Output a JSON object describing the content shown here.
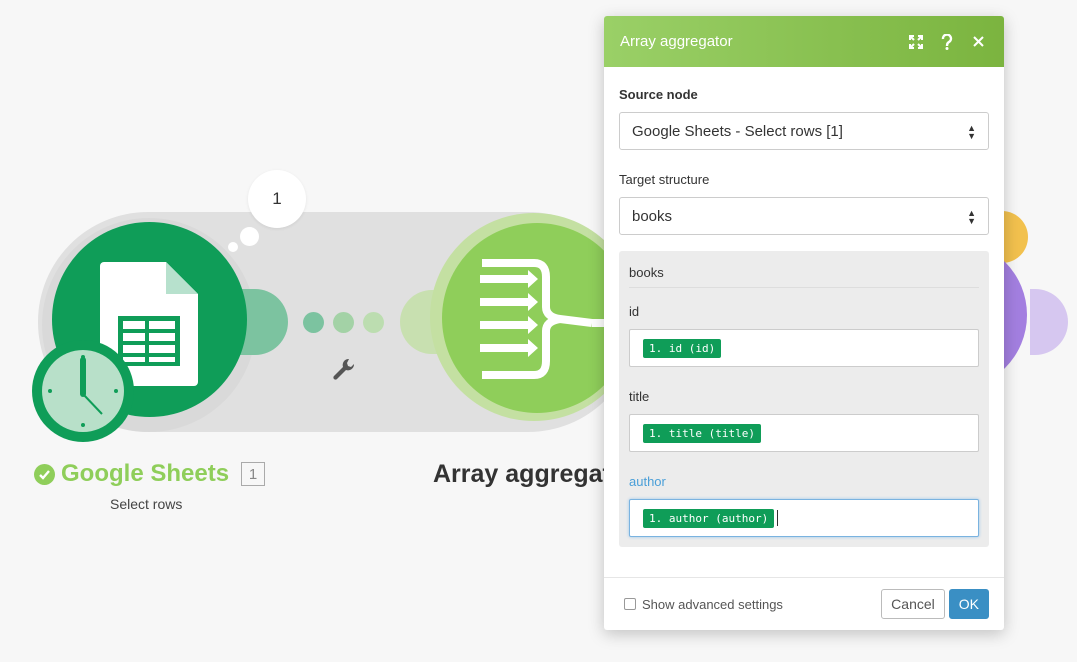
{
  "canvas": {
    "modules": [
      {
        "title": "Google Sheets",
        "subtitle": "Select rows",
        "badge": "1",
        "bubble_count": "1",
        "color": "#0f9d58",
        "icon": "google-sheets-icon"
      },
      {
        "title": "Array aggregator",
        "color": "#8fce5a",
        "icon": "array-aggregator-icon"
      }
    ],
    "connector_icon": "wrench-icon"
  },
  "dialog": {
    "title": "Array aggregator",
    "header_icons": [
      "expand-icon",
      "help-icon",
      "close-icon"
    ],
    "source_node": {
      "label": "Source node",
      "value": "Google Sheets - Select rows [1]"
    },
    "target_structure": {
      "label": "Target structure",
      "value": "books"
    },
    "structure": {
      "name": "books",
      "fields": [
        {
          "label": "id",
          "value": "1. id (id)"
        },
        {
          "label": "title",
          "value": "1. title (title)"
        },
        {
          "label": "author",
          "value": "1. author (author)"
        }
      ]
    },
    "footer": {
      "advanced_label": "Show advanced settings",
      "cancel_label": "Cancel",
      "ok_label": "OK"
    }
  }
}
